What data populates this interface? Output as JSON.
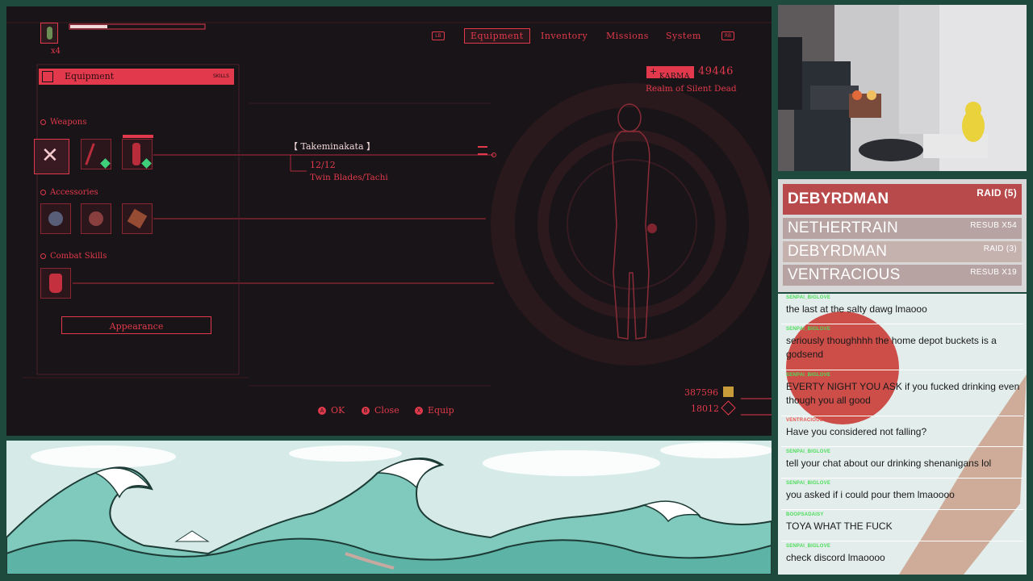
{
  "game": {
    "item_count": "x4",
    "tabs": [
      {
        "label": "Equipment",
        "active": true
      },
      {
        "label": "Inventory",
        "active": false
      },
      {
        "label": "Missions",
        "active": false
      },
      {
        "label": "System",
        "active": false
      }
    ],
    "bumper_left": "LB",
    "bumper_right": "RB",
    "panel_title": "Equipment",
    "panel_tag": "SKILLS",
    "karma_label": "KARMA",
    "karma_value": "49446",
    "location": "Realm of Silent Dead",
    "sections": {
      "weapons": "Weapons",
      "accessories": "Accessories",
      "combat_skills": "Combat Skills"
    },
    "weapon_name": "【 Takeminakata 】",
    "weapon_count": "12/12",
    "weapon_type": "Twin Blades/Tachi",
    "appearance_label": "Appearance",
    "currency_1": "387596",
    "currency_2": "18012",
    "controls": [
      {
        "key": "A",
        "label": "OK"
      },
      {
        "key": "B",
        "label": "Close"
      },
      {
        "key": "X",
        "label": "Equip"
      }
    ],
    "accent_color": "#e23a4c"
  },
  "events": [
    {
      "name": "DEBYRDMAN",
      "tag": "RAID (5)"
    },
    {
      "name": "NETHERTRAIN",
      "tag": "RESUB X54"
    },
    {
      "name": "DEBYRDMAN",
      "tag": "RAID (3)"
    },
    {
      "name": "VENTRACIOUS",
      "tag": "RESUB X19"
    }
  ],
  "chat": [
    {
      "user": "SENPAI_BIGLOVE",
      "text": "the last at the salty dawg lmaooo"
    },
    {
      "user": "SENPAI_BIGLOVE",
      "text": "seriously thoughhhh the home depot buckets is a godsend"
    },
    {
      "user": "SENPAI_BIGLOVE",
      "text": "EVERTY NIGHT YOU ASK if you fucked drinking even though you all good"
    },
    {
      "user": "VENTRACIOUS",
      "text": "Have you considered not falling?"
    },
    {
      "user": "SENPAI_BIGLOVE",
      "text": "tell your chat about our drinking shenanigans lol"
    },
    {
      "user": "SENPAI_BIGLOVE",
      "text": "you asked if i could pour them lmaoooo"
    },
    {
      "user": "BOOPSADAISY",
      "text": "TOYA WHAT THE FUCK"
    },
    {
      "user": "SENPAI_BIGLOVE",
      "text": "check discord lmaoooo"
    }
  ]
}
